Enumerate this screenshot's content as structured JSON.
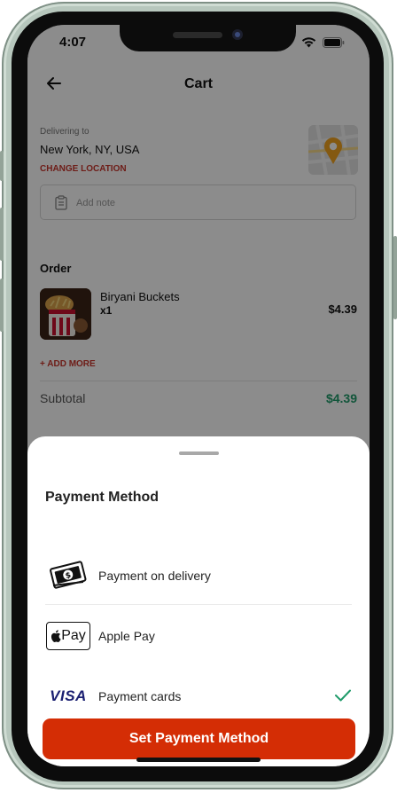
{
  "status_bar": {
    "time": "4:07"
  },
  "header": {
    "title": "Cart"
  },
  "delivery": {
    "label": "Delivering to",
    "address": "New York, NY, USA",
    "change_location": "CHANGE LOCATION"
  },
  "note": {
    "placeholder": "Add note"
  },
  "order": {
    "heading": "Order",
    "items": [
      {
        "name": "Biryani Buckets",
        "quantity": "x1",
        "price": "$4.39"
      }
    ],
    "add_more": "+ ADD MORE"
  },
  "summary": {
    "subtotal_label": "Subtotal",
    "subtotal_value": "$4.39"
  },
  "payment_sheet": {
    "title": "Payment Method",
    "methods": [
      {
        "label": "Payment on delivery",
        "icon": "cash-icon",
        "selected": false
      },
      {
        "label": "Apple Pay",
        "icon": "apple-pay-logo",
        "badge_text": "Pay",
        "selected": false
      },
      {
        "label": "Payment cards",
        "icon": "visa-logo",
        "badge_text": "VISA",
        "selected": true
      }
    ],
    "button_label": "Set Payment Method"
  },
  "colors": {
    "accent_red": "#d42d05",
    "link_red": "#c8352d",
    "price_green": "#1f9b6a",
    "check_green": "#1f9b6a",
    "visa_blue": "#1a1f71"
  }
}
